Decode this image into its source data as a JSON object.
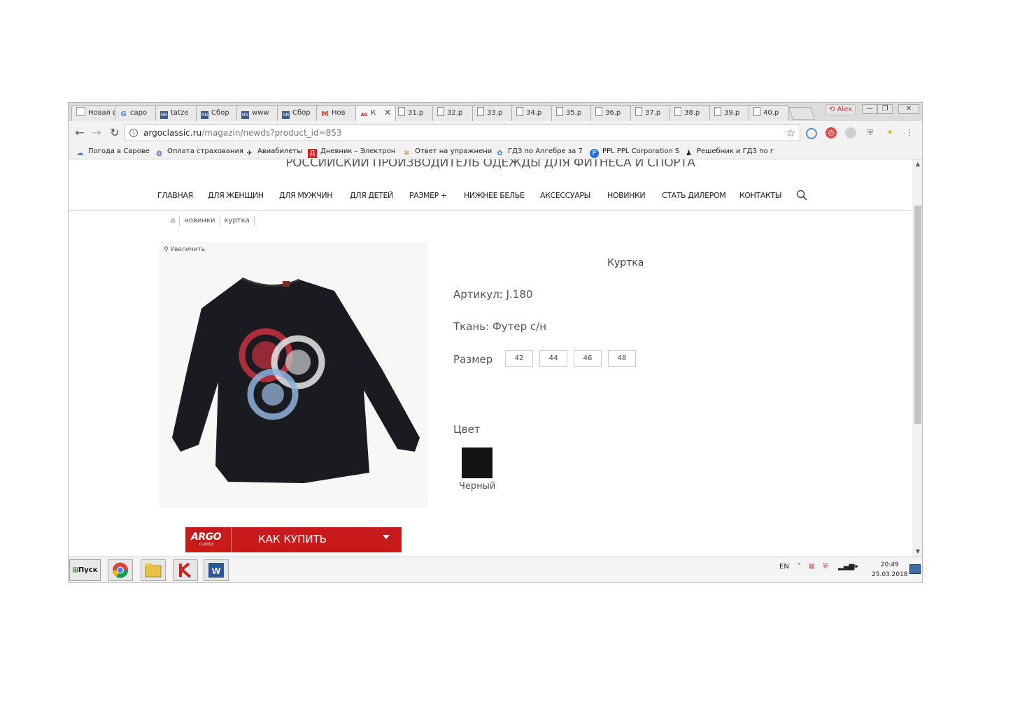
{
  "browser": {
    "tabs": [
      {
        "label": "Новая вк",
        "icon": "page-icon"
      },
      {
        "label": "саро",
        "icon": "google-icon"
      },
      {
        "label": "tatze",
        "icon": "nn-icon"
      },
      {
        "label": "Сбор",
        "icon": "nn-icon"
      },
      {
        "label": "www",
        "icon": "nn-icon"
      },
      {
        "label": "Сбор",
        "icon": "nn-icon"
      },
      {
        "label": "Нов",
        "icon": "gmail-icon"
      },
      {
        "label": "К",
        "icon": "argo-icon"
      },
      {
        "label": "31.p",
        "icon": "doc-icon"
      },
      {
        "label": "32.p",
        "icon": "doc-icon"
      },
      {
        "label": "33.p",
        "icon": "doc-icon"
      },
      {
        "label": "34.p",
        "icon": "doc-icon"
      },
      {
        "label": "35.p",
        "icon": "doc-icon"
      },
      {
        "label": "36.p",
        "icon": "doc-icon"
      },
      {
        "label": "37.p",
        "icon": "doc-icon"
      },
      {
        "label": "38.p",
        "icon": "doc-icon"
      },
      {
        "label": "39.p",
        "icon": "doc-icon"
      },
      {
        "label": "40.p",
        "icon": "doc-icon"
      }
    ],
    "user": "Alex",
    "url_domain": "argoclassic.ru",
    "url_path": "/magazin/newds?product_id=853",
    "bookmarks": [
      "Погода в Сарове",
      "Оплата страхования",
      "Авиабилеты",
      "Дневник – Электрон",
      "Ответ на упражнени",
      "ГДЗ по Алгебре за 7",
      "PPL PPL Corporation S",
      "Решебник и ГДЗ по г"
    ]
  },
  "site": {
    "tagline": "РОССИЙСКИЙ ПРОИЗВОДИТЕЛЬ ОДЕЖДЫ ДЛЯ ФИТНЕСА И СПОРТА",
    "menu": [
      "ГЛАВНАЯ",
      "ДЛЯ ЖЕНЩИН",
      "ДЛЯ МУЖЧИН",
      "ДЛЯ ДЕТЕЙ",
      "РАЗМЕР +",
      "НИЖНЕЕ БЕЛЬЕ",
      "АКСЕССУАРЫ",
      "НОВИНКИ",
      "СТАТЬ ДИЛЕРОМ",
      "КОНТАКТЫ"
    ],
    "breadcrumbs": [
      "новинки",
      "куртка"
    ],
    "zoom_label": "Увеличить"
  },
  "product": {
    "title": "Куртка",
    "article": "Артикул: J.180",
    "fabric": "Ткань: Футер с/н",
    "size_label": "Размер",
    "sizes": [
      "42",
      "44",
      "46",
      "48"
    ],
    "color_label": "Цвет",
    "color_name": "Черный",
    "color_hex": "#141414"
  },
  "banner": {
    "logo": "ARGO",
    "logo_sub": "CLASSIC",
    "text": "КАК КУПИТЬ",
    "color": "#c8191b"
  },
  "taskbar": {
    "start": "Пуск",
    "lang": "EN",
    "time": "20:49",
    "date": "25.03.2018"
  }
}
